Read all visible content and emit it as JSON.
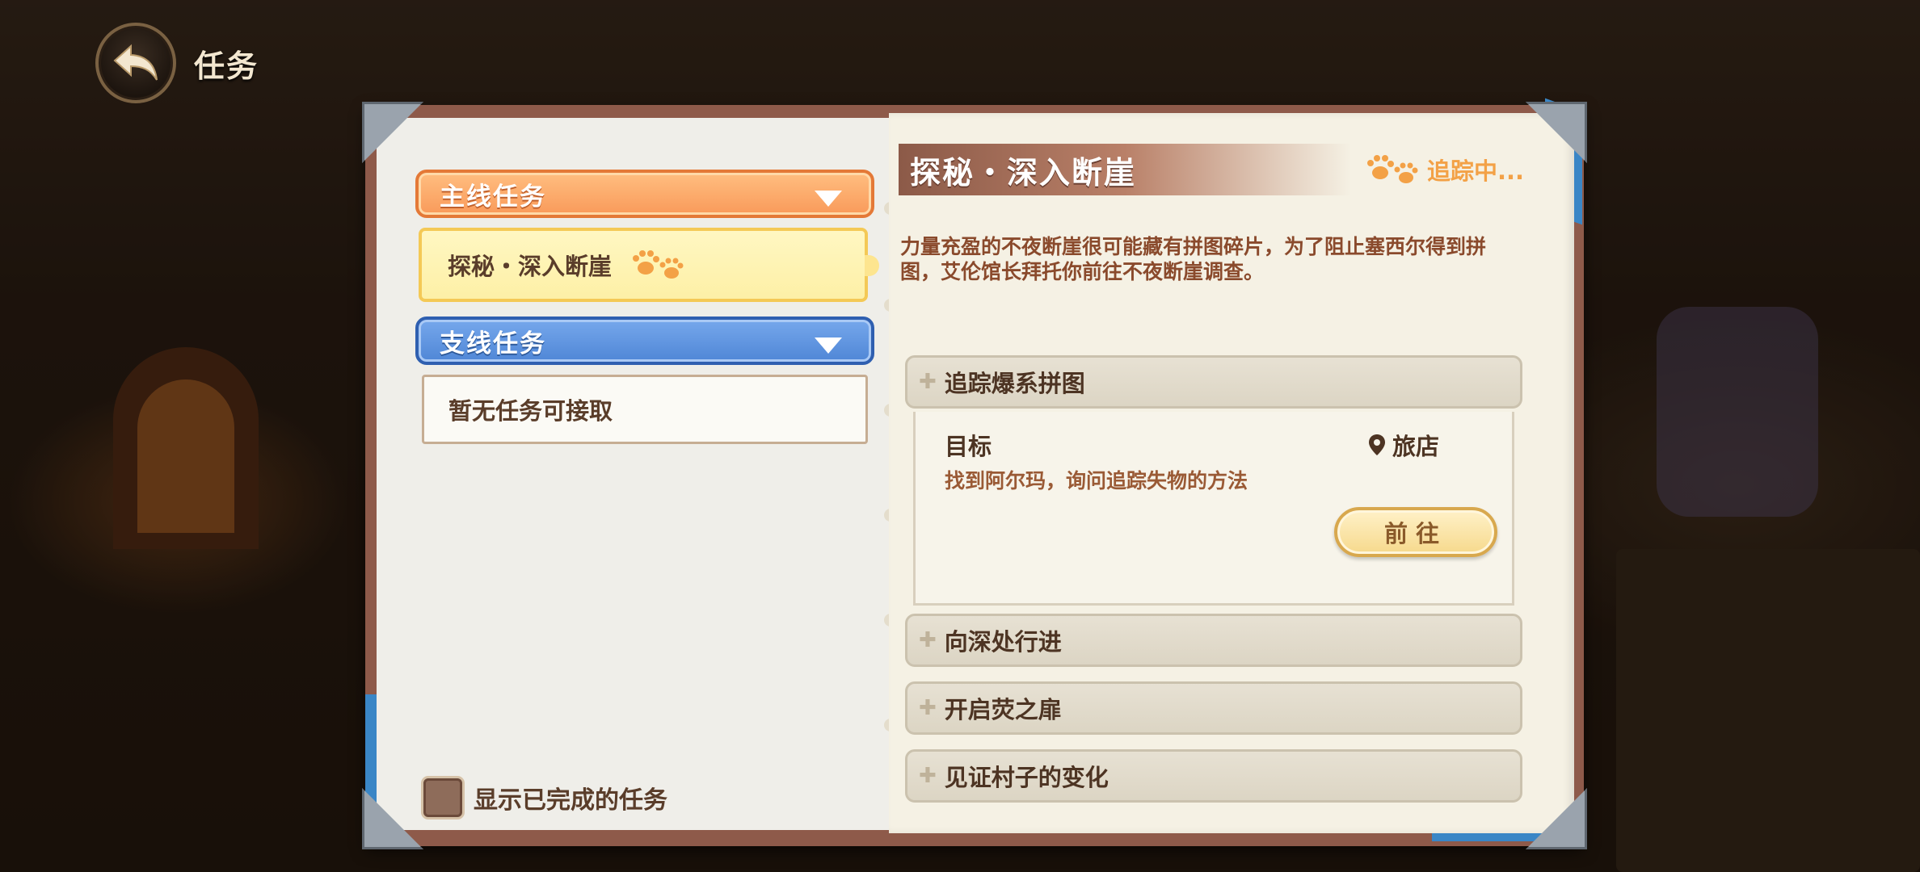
{
  "header": {
    "title": "任务",
    "back_icon": "back-arrow-icon"
  },
  "left": {
    "main_category": "主线任务",
    "main_quests": [
      {
        "label": "探秘・深入断崖",
        "tracked": true
      }
    ],
    "side_category": "支线任务",
    "side_empty": "暂无任务可接取",
    "show_completed_label": "显示已完成的任务"
  },
  "detail": {
    "title": "探秘・深入断崖",
    "tracking_status": "追踪中...",
    "description": "力量充盈的不夜断崖很可能藏有拼图碎片，为了阻止塞西尔得到拼图，艾伦馆长拜托你前往不夜断崖调查。",
    "steps": [
      {
        "title": "追踪爆系拼图",
        "expanded": true,
        "objective_label": "目标",
        "location": "旅店",
        "objective_text": "找到阿尔玛，询问追踪失物的方法",
        "go_label": "前往"
      },
      {
        "title": "向深处行进"
      },
      {
        "title": "开启荧之扉"
      },
      {
        "title": "见证村子的变化"
      }
    ]
  },
  "colors": {
    "main_tab": "#f99a5a",
    "side_tab": "#4f86d6",
    "highlight": "#fdf0a6",
    "tracking": "#f3a146"
  }
}
